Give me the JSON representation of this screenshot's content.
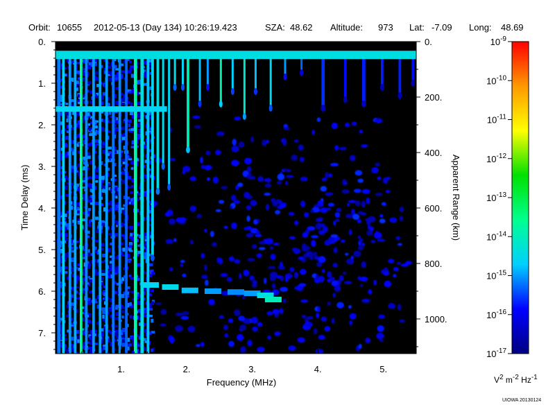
{
  "header": {
    "orbit_label": "Orbit:",
    "orbit_value": "10655",
    "datetime": "2012-05-13 (Day 134) 10:26:19.423",
    "sza_label": "SZA:",
    "sza_value": "48.62",
    "altitude_label": "Altitude:",
    "altitude_value": "973",
    "lat_label": "Lat:",
    "lat_value": "-7.09",
    "long_label": "Long:",
    "long_value": "48.69"
  },
  "footer": {
    "credit": "UIOWA 20130124"
  },
  "colorbar": {
    "units_html": "V<sup>2</sup> m<sup>-2</sup> Hz<sup>-1</sup>",
    "tick_labels": [
      {
        "base": "10",
        "exp": "-9"
      },
      {
        "base": "10",
        "exp": "-10"
      },
      {
        "base": "10",
        "exp": "-11"
      },
      {
        "base": "10",
        "exp": "-12"
      },
      {
        "base": "10",
        "exp": "-13"
      },
      {
        "base": "10",
        "exp": "-14"
      },
      {
        "base": "10",
        "exp": "-15"
      },
      {
        "base": "10",
        "exp": "-16"
      },
      {
        "base": "10",
        "exp": "-17"
      }
    ],
    "log_range": [
      -17,
      -9
    ],
    "colors": [
      "#000080",
      "#0000ff",
      "#00d0ff",
      "#00ff90",
      "#00e000",
      "#ffff00",
      "#ff9900",
      "#ff0000"
    ]
  },
  "chart_data": {
    "type": "heatmap",
    "title": "",
    "xlabel": "Frequency (MHz)",
    "ylabel": "Time Delay (ms)",
    "y2label": "Apparent Range (km)",
    "xlim": [
      0.0,
      5.5
    ],
    "ylim": [
      0.0,
      7.5
    ],
    "y2lim": [
      0,
      1125
    ],
    "x_ticks": [
      {
        "value": 1,
        "label": "1."
      },
      {
        "value": 2,
        "label": "2."
      },
      {
        "value": 3,
        "label": "3."
      },
      {
        "value": 4,
        "label": "4."
      },
      {
        "value": 5,
        "label": "5."
      }
    ],
    "y_ticks": [
      {
        "value": 0,
        "label": "0."
      },
      {
        "value": 1,
        "label": "1."
      },
      {
        "value": 2,
        "label": "2."
      },
      {
        "value": 3,
        "label": "3."
      },
      {
        "value": 4,
        "label": "4."
      },
      {
        "value": 5,
        "label": "5."
      },
      {
        "value": 6,
        "label": "6."
      },
      {
        "value": 7,
        "label": "7."
      }
    ],
    "y2_ticks": [
      {
        "value": 0,
        "label": "0."
      },
      {
        "value": 200,
        "label": "200."
      },
      {
        "value": 400,
        "label": "400."
      },
      {
        "value": 600,
        "label": "600."
      },
      {
        "value": 800,
        "label": "800."
      },
      {
        "value": 1000,
        "label": "1000."
      }
    ],
    "background": "#000000",
    "top_band": {
      "y_range": [
        0.22,
        0.42
      ],
      "log_value": -14.4
    },
    "columns": [
      {
        "f": 0.05,
        "t_end": 7.5,
        "w": 0.05,
        "log_value": -15.2
      },
      {
        "f": 0.12,
        "t_end": 7.5,
        "w": 0.04,
        "log_value": -14.7
      },
      {
        "f": 0.22,
        "t_end": 7.5,
        "w": 0.04,
        "log_value": -15.0
      },
      {
        "f": 0.3,
        "t_end": 7.5,
        "w": 0.04,
        "log_value": -14.9
      },
      {
        "f": 0.39,
        "t_end": 7.5,
        "w": 0.04,
        "log_value": -13.6
      },
      {
        "f": 0.47,
        "t_end": 7.5,
        "w": 0.04,
        "log_value": -15.1
      },
      {
        "f": 0.58,
        "t_end": 7.5,
        "w": 0.04,
        "log_value": -15.0
      },
      {
        "f": 0.68,
        "t_end": 7.5,
        "w": 0.04,
        "log_value": -14.9
      },
      {
        "f": 0.78,
        "t_end": 7.5,
        "w": 0.04,
        "log_value": -15.0
      },
      {
        "f": 0.88,
        "t_end": 7.5,
        "w": 0.04,
        "log_value": -15.2
      },
      {
        "f": 0.98,
        "t_end": 7.5,
        "w": 0.04,
        "log_value": -15.1
      },
      {
        "f": 1.08,
        "t_end": 7.5,
        "w": 0.04,
        "log_value": -15.3
      },
      {
        "f": 1.22,
        "t_end": 7.5,
        "w": 0.05,
        "log_value": -13.8
      },
      {
        "f": 1.32,
        "t_end": 7.5,
        "w": 0.05,
        "log_value": -14.4
      },
      {
        "f": 1.41,
        "t_end": 7.5,
        "w": 0.04,
        "log_value": -14.8
      },
      {
        "f": 1.48,
        "t_end": 5.2,
        "w": 0.04,
        "log_value": -14.6
      },
      {
        "f": 1.56,
        "t_end": 3.6,
        "w": 0.04,
        "log_value": -14.4
      },
      {
        "f": 1.64,
        "t_end": 3.0,
        "w": 0.03,
        "log_value": -14.5
      },
      {
        "f": 1.73,
        "t_end": 3.5,
        "w": 0.03,
        "log_value": -14.6
      },
      {
        "f": 1.82,
        "t_end": 1.1,
        "w": 0.03,
        "log_value": -14.5
      },
      {
        "f": 1.94,
        "t_end": 1.1,
        "w": 0.03,
        "log_value": -14.6
      },
      {
        "f": 2.02,
        "t_end": 2.6,
        "w": 0.04,
        "log_value": -14.0
      },
      {
        "f": 2.2,
        "t_end": 1.5,
        "w": 0.03,
        "log_value": -14.8
      },
      {
        "f": 2.32,
        "t_end": 1.1,
        "w": 0.03,
        "log_value": -15.0
      },
      {
        "f": 2.52,
        "t_end": 1.5,
        "w": 0.03,
        "log_value": -13.9
      },
      {
        "f": 2.7,
        "t_end": 1.2,
        "w": 0.03,
        "log_value": -14.7
      },
      {
        "f": 2.88,
        "t_end": 1.8,
        "w": 0.03,
        "log_value": -14.2
      },
      {
        "f": 3.05,
        "t_end": 1.2,
        "w": 0.03,
        "log_value": -14.8
      },
      {
        "f": 3.28,
        "t_end": 1.6,
        "w": 0.03,
        "log_value": -14.6
      },
      {
        "f": 3.5,
        "t_end": 0.85,
        "w": 0.03,
        "log_value": -15.0
      },
      {
        "f": 3.75,
        "t_end": 0.75,
        "w": 0.03,
        "log_value": -15.3
      },
      {
        "f": 4.08,
        "t_end": 1.6,
        "w": 0.05,
        "log_value": -15.6
      },
      {
        "f": 4.42,
        "t_end": 1.4,
        "w": 0.04,
        "log_value": -15.8
      },
      {
        "f": 4.7,
        "t_end": 1.5,
        "w": 0.05,
        "log_value": -15.7
      },
      {
        "f": 4.98,
        "t_end": 1.1,
        "w": 0.04,
        "log_value": -15.7
      },
      {
        "f": 5.25,
        "t_end": 1.3,
        "w": 0.04,
        "log_value": -15.7
      },
      {
        "f": 5.45,
        "t_end": 1.0,
        "w": 0.04,
        "log_value": -15.8
      }
    ],
    "horizontal_band": {
      "f_start": 1.2,
      "f_end": 1.7,
      "t": 1.62,
      "log_value": -14.6
    },
    "oblique_echo": [
      {
        "f": 1.45,
        "t": 5.85,
        "log_value": -14.6
      },
      {
        "f": 1.75,
        "t": 5.9,
        "log_value": -14.5
      },
      {
        "f": 2.05,
        "t": 5.98,
        "log_value": -14.8
      },
      {
        "f": 2.4,
        "t": 6.0,
        "log_value": -15.0
      },
      {
        "f": 2.75,
        "t": 6.02,
        "log_value": -15.1
      },
      {
        "f": 3.0,
        "t": 6.05,
        "log_value": -15.0
      },
      {
        "f": 3.2,
        "t": 6.1,
        "log_value": -14.4
      },
      {
        "f": 3.32,
        "t": 6.2,
        "log_value": -14.0
      }
    ],
    "noise": {
      "f_range": [
        1.4,
        5.5
      ],
      "t_range": [
        1.8,
        7.5
      ],
      "center_f": 3.6,
      "center_t": 4.8,
      "log_range": [
        -16.8,
        -15.6
      ]
    }
  }
}
